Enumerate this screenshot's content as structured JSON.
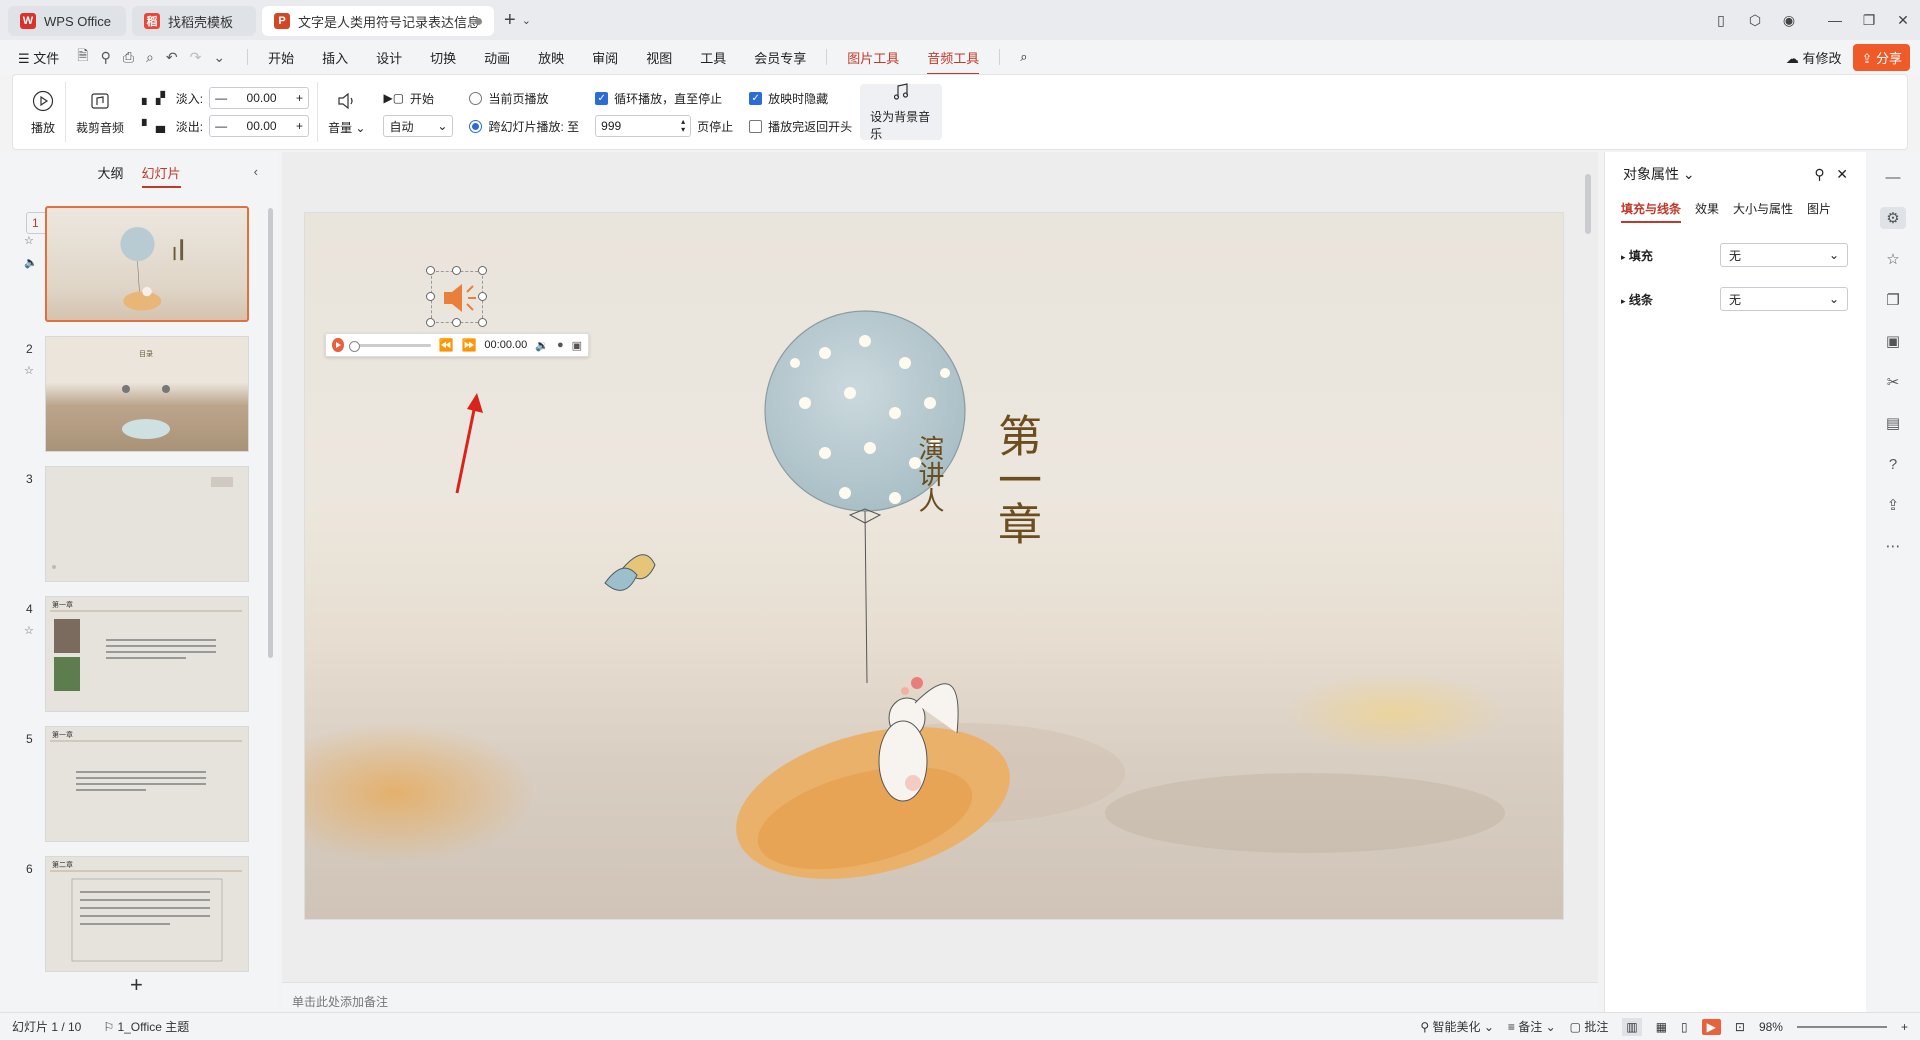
{
  "tabs": [
    {
      "label": "WPS Office",
      "icon": "wps-logo-icon",
      "color": "#d9312b"
    },
    {
      "label": "找稻壳模板",
      "icon": "docer-icon",
      "color": "#e8473a"
    },
    {
      "label": "文字是人类用符号记录表达信息以",
      "icon": "ppt-icon",
      "color": "#d24726"
    }
  ],
  "menu": {
    "file": "文件",
    "items": [
      "开始",
      "插入",
      "设计",
      "切换",
      "动画",
      "放映",
      "审阅",
      "视图",
      "工具",
      "会员专享",
      "图片工具",
      "音频工具"
    ],
    "active_items": [
      "图片工具",
      "音频工具"
    ],
    "changed": "有修改",
    "share": "分享"
  },
  "ribbon": {
    "play": "播放",
    "trim": "裁剪音频",
    "fade_in_label": "淡入:",
    "fade_in_value": "00.00",
    "fade_out_label": "淡出:",
    "fade_out_value": "00.00",
    "volume": "音量",
    "start_label": "开始",
    "start_select": "自动",
    "current_page": "当前页播放",
    "cross_slides": "跨幻灯片播放: 至",
    "cross_value": "999",
    "page_stop": "页停止",
    "loop": "循环播放，直至停止",
    "rewind": "播放完返回开头",
    "hide": "放映时隐藏",
    "bg_music": "设为背景音乐",
    "loop_checked": true,
    "hide_checked": true,
    "rewind_checked": false,
    "current_page_selected": false,
    "cross_selected": true
  },
  "left_panel": {
    "tab_outline": "大纲",
    "tab_slides": "幻灯片",
    "slides": [
      {
        "num": "1",
        "title": ""
      },
      {
        "num": "2",
        "title": "目录"
      },
      {
        "num": "3",
        "title": ""
      },
      {
        "num": "4",
        "title": "第一章"
      },
      {
        "num": "5",
        "title": "第一章"
      },
      {
        "num": "6",
        "title": "第二章"
      }
    ],
    "add": "+"
  },
  "slide": {
    "chapter": "第一章",
    "presenter": "演讲人",
    "time": "00:00.00"
  },
  "notes": {
    "placeholder": "单击此处添加备注"
  },
  "right_panel": {
    "title": "对象属性",
    "tabs": [
      "填充与线条",
      "效果",
      "大小与属性",
      "图片"
    ],
    "fill_label": "填充",
    "fill_value": "无",
    "line_label": "线条",
    "line_value": "无"
  },
  "status": {
    "slide_count": "幻灯片 1 / 10",
    "theme": "1_Office 主题",
    "beautify": "智能美化",
    "notes": "备注",
    "comments": "批注",
    "zoom": "98%"
  },
  "colors": {
    "accent": "#c0392b",
    "speaker": "#e8803c",
    "share": "#f05a28",
    "checkbox": "#2c6cd6",
    "arrow": "#d9241c"
  }
}
